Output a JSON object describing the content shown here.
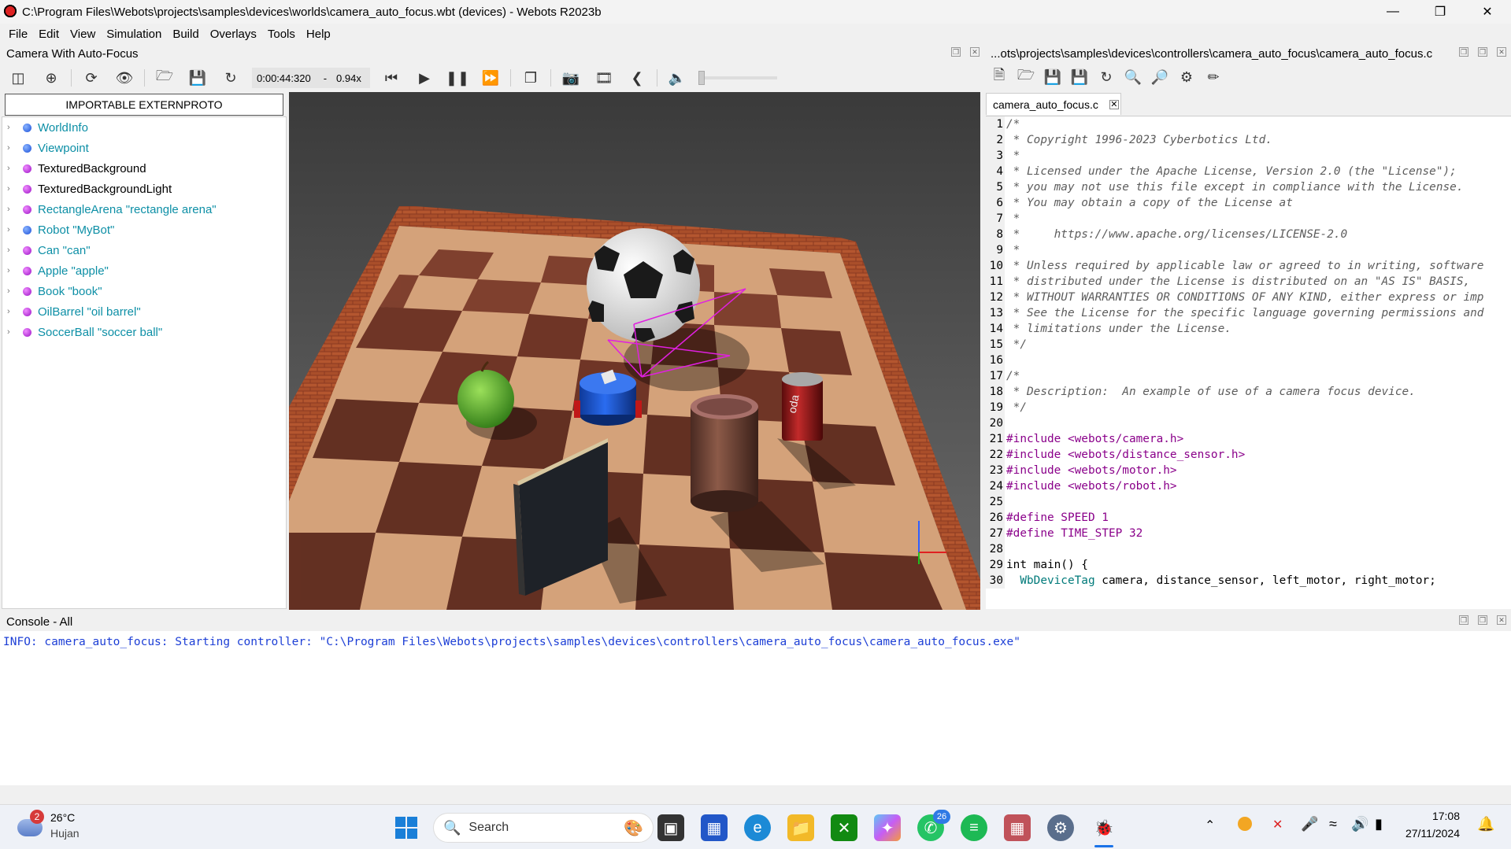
{
  "window": {
    "title": "C:\\Program Files\\Webots\\projects\\samples\\devices\\worlds\\camera_auto_focus.wbt (devices) - Webots R2023b"
  },
  "menu": [
    "File",
    "Edit",
    "View",
    "Simulation",
    "Build",
    "Overlays",
    "Tools",
    "Help"
  ],
  "scene_panel": {
    "title": "Camera With Auto-Focus",
    "externproto_button": "IMPORTABLE EXTERNPROTO"
  },
  "simulation": {
    "time": "0:00:44:320",
    "speed_sep": "-",
    "speed": "0.94x"
  },
  "scene_tree": [
    {
      "label": "WorldInfo",
      "color": "blue",
      "teal": true
    },
    {
      "label": "Viewpoint",
      "color": "blue",
      "teal": true
    },
    {
      "label": "TexturedBackground",
      "color": "purple",
      "teal": false
    },
    {
      "label": "TexturedBackgroundLight",
      "color": "purple",
      "teal": false
    },
    {
      "label": "RectangleArena \"rectangle arena\"",
      "color": "purple",
      "teal": true
    },
    {
      "label": "Robot \"MyBot\"",
      "color": "blue",
      "teal": true
    },
    {
      "label": "Can \"can\"",
      "color": "purple",
      "teal": true
    },
    {
      "label": "Apple \"apple\"",
      "color": "purple",
      "teal": true
    },
    {
      "label": "Book \"book\"",
      "color": "purple",
      "teal": true
    },
    {
      "label": "OilBarrel \"oil barrel\"",
      "color": "purple",
      "teal": true
    },
    {
      "label": "SoccerBall \"soccer ball\"",
      "color": "purple",
      "teal": true
    }
  ],
  "editor": {
    "path": "...ots\\projects\\samples\\devices\\controllers\\camera_auto_focus\\camera_auto_focus.c",
    "tab": "camera_auto_focus.c",
    "lines": [
      {
        "n": "1",
        "t": "/*",
        "c": "cm"
      },
      {
        "n": "2",
        "t": " * Copyright 1996-2023 Cyberbotics Ltd.",
        "c": "cm"
      },
      {
        "n": "3",
        "t": " *",
        "c": "cm"
      },
      {
        "n": "4",
        "t": " * Licensed under the Apache License, Version 2.0 (the \"License\");",
        "c": "cm"
      },
      {
        "n": "5",
        "t": " * you may not use this file except in compliance with the License.",
        "c": "cm"
      },
      {
        "n": "6",
        "t": " * You may obtain a copy of the License at",
        "c": "cm"
      },
      {
        "n": "7",
        "t": " *",
        "c": "cm"
      },
      {
        "n": "8",
        "t": " *     https://www.apache.org/licenses/LICENSE-2.0",
        "c": "cm"
      },
      {
        "n": "9",
        "t": " *",
        "c": "cm"
      },
      {
        "n": "10",
        "t": " * Unless required by applicable law or agreed to in writing, software",
        "c": "cm"
      },
      {
        "n": "11",
        "t": " * distributed under the License is distributed on an \"AS IS\" BASIS,",
        "c": "cm"
      },
      {
        "n": "12",
        "t": " * WITHOUT WARRANTIES OR CONDITIONS OF ANY KIND, either express or imp",
        "c": "cm"
      },
      {
        "n": "13",
        "t": " * See the License for the specific language governing permissions and",
        "c": "cm"
      },
      {
        "n": "14",
        "t": " * limitations under the License.",
        "c": "cm"
      },
      {
        "n": "15",
        "t": " */",
        "c": "cm"
      },
      {
        "n": "16",
        "t": "",
        "c": "kw"
      },
      {
        "n": "17",
        "t": "/*",
        "c": "cm"
      },
      {
        "n": "18",
        "t": " * Description:  An example of use of a camera focus device.",
        "c": "cm"
      },
      {
        "n": "19",
        "t": " */",
        "c": "cm"
      },
      {
        "n": "20",
        "t": "",
        "c": "kw"
      },
      {
        "n": "21",
        "t": "#include <webots/camera.h>",
        "c": "pp"
      },
      {
        "n": "22",
        "t": "#include <webots/distance_sensor.h>",
        "c": "pp"
      },
      {
        "n": "23",
        "t": "#include <webots/motor.h>",
        "c": "pp"
      },
      {
        "n": "24",
        "t": "#include <webots/robot.h>",
        "c": "pp"
      },
      {
        "n": "25",
        "t": "",
        "c": "kw"
      },
      {
        "n": "26",
        "t": "#define SPEED 1",
        "c": "pp"
      },
      {
        "n": "27",
        "t": "#define TIME_STEP 32",
        "c": "pp"
      },
      {
        "n": "28",
        "t": "",
        "c": "kw"
      },
      {
        "n": "29",
        "t": "int main() {",
        "c": "kw"
      },
      {
        "n": "30",
        "t": "  WbDeviceTag camera, distance_sensor, left_motor, right_motor;",
        "c": "kw"
      }
    ]
  },
  "console": {
    "title": "Console - All",
    "message": "INFO: camera_auto_focus: Starting controller: \"C:\\Program Files\\Webots\\projects\\samples\\devices\\controllers\\camera_auto_focus\\camera_auto_focus.exe\""
  },
  "taskbar": {
    "weather_temp": "26°C",
    "weather_desc": "Hujan",
    "weather_badge": "2",
    "search": "Search",
    "whatsapp_badge": "26",
    "time": "17:08",
    "date": "27/11/2024"
  }
}
